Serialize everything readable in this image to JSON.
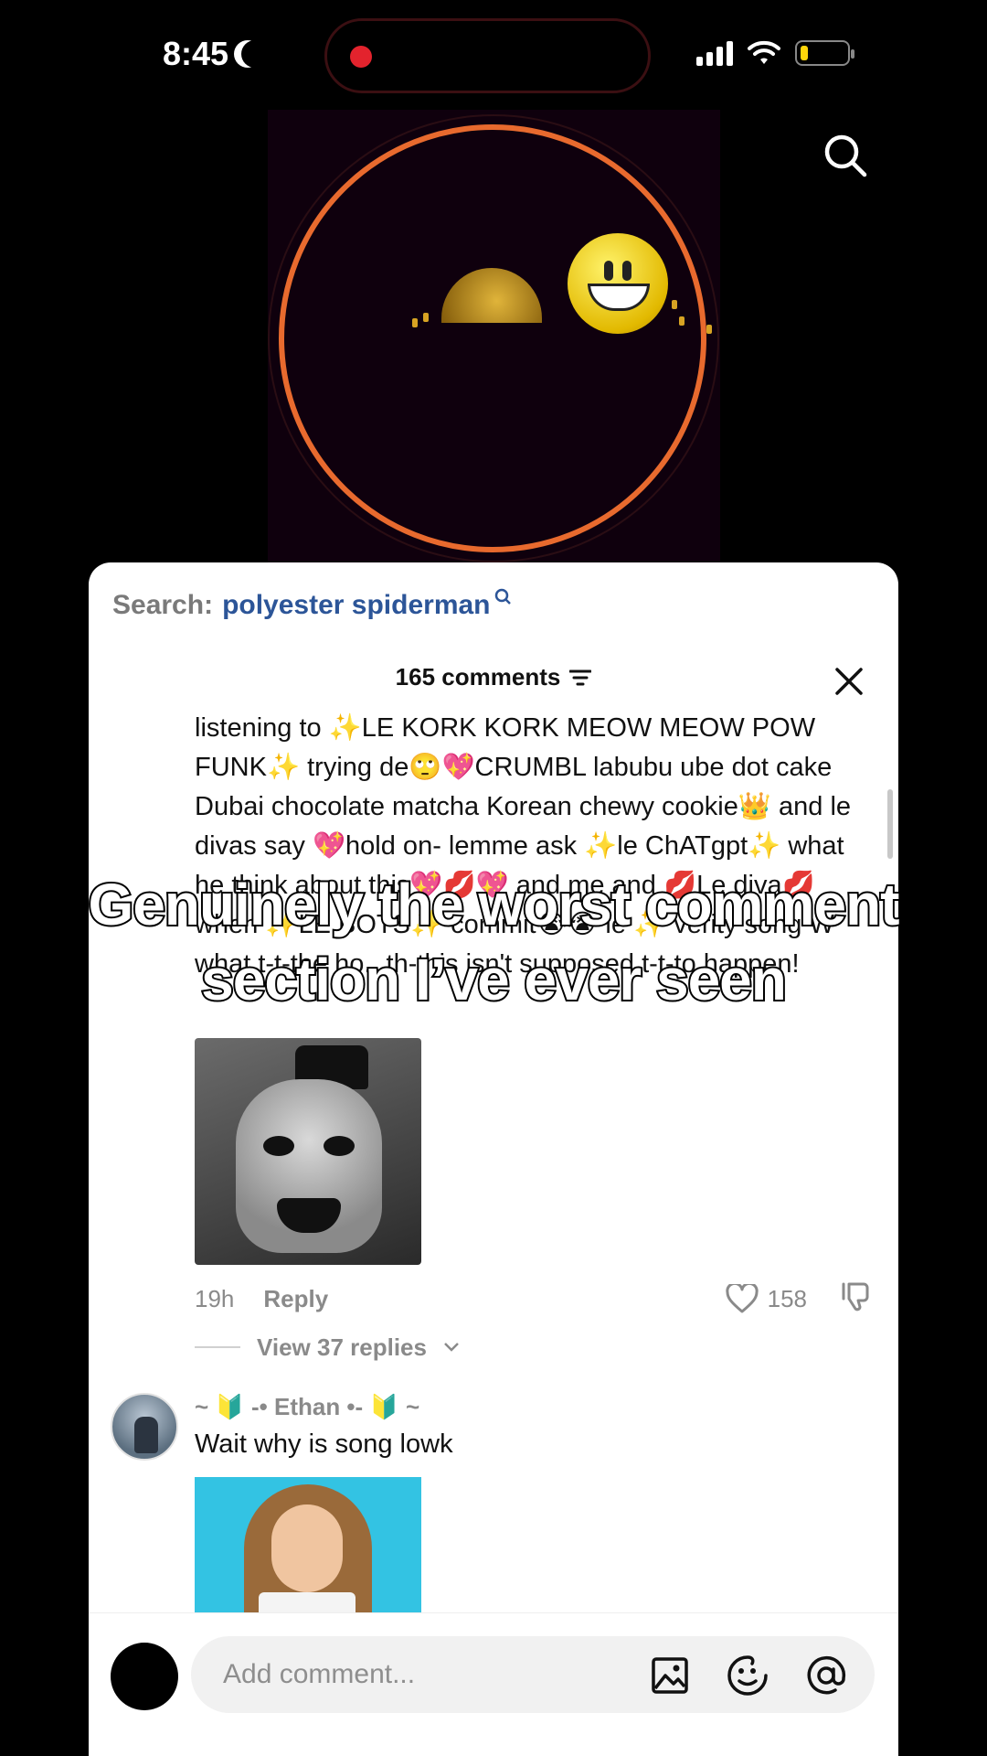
{
  "status_bar": {
    "time": "8:45"
  },
  "sheet": {
    "search_label": "Search:",
    "search_term": "polyester spiderman",
    "comments_count": "165 comments",
    "comment1": {
      "text": "listening to ✨LE KORK KORK MEOW MEOW POW FUNK✨ trying de🙄💖CRUMBL labubu ube dot cake Dubai chocolate matcha Korean chewy cookie👑 and le divas say 💖hold on- lemme ask ✨le ChATgpt✨ what he think about this💖💋💖 and me and 💋Le diva💋when ✨LE BOTS✨ commit😭😭 le ✨ verity song W what t-t-the ho.. th-this isn't supposed t-t-to happen!",
      "time_ago": "19h",
      "reply_label": "Reply",
      "likes": "158",
      "view_replies": "View 37 replies"
    },
    "comment2": {
      "username": "~ 🔰 -• Ethan •- 🔰 ~",
      "text": "Wait why is song lowk"
    },
    "composer": {
      "placeholder": "Add comment..."
    }
  },
  "caption": {
    "line1": "Genuinely the worst comment",
    "line2": "section I’ve ever seen"
  },
  "icons": {
    "status": [
      "moon-icon",
      "signal-icon",
      "wifi-icon",
      "battery-icon"
    ],
    "video": [
      "search-icon"
    ],
    "sheet": [
      "sort-icon",
      "close-icon",
      "heart-icon",
      "dislike-icon",
      "chevron-down-icon",
      "image-icon",
      "emoji-icon",
      "mention-icon"
    ]
  },
  "colors": {
    "search_term": "#2c5598",
    "muted": "#8a8a8a",
    "ring": "#e86a2e",
    "record": "#e3232d",
    "battery": "#ffd60a"
  }
}
